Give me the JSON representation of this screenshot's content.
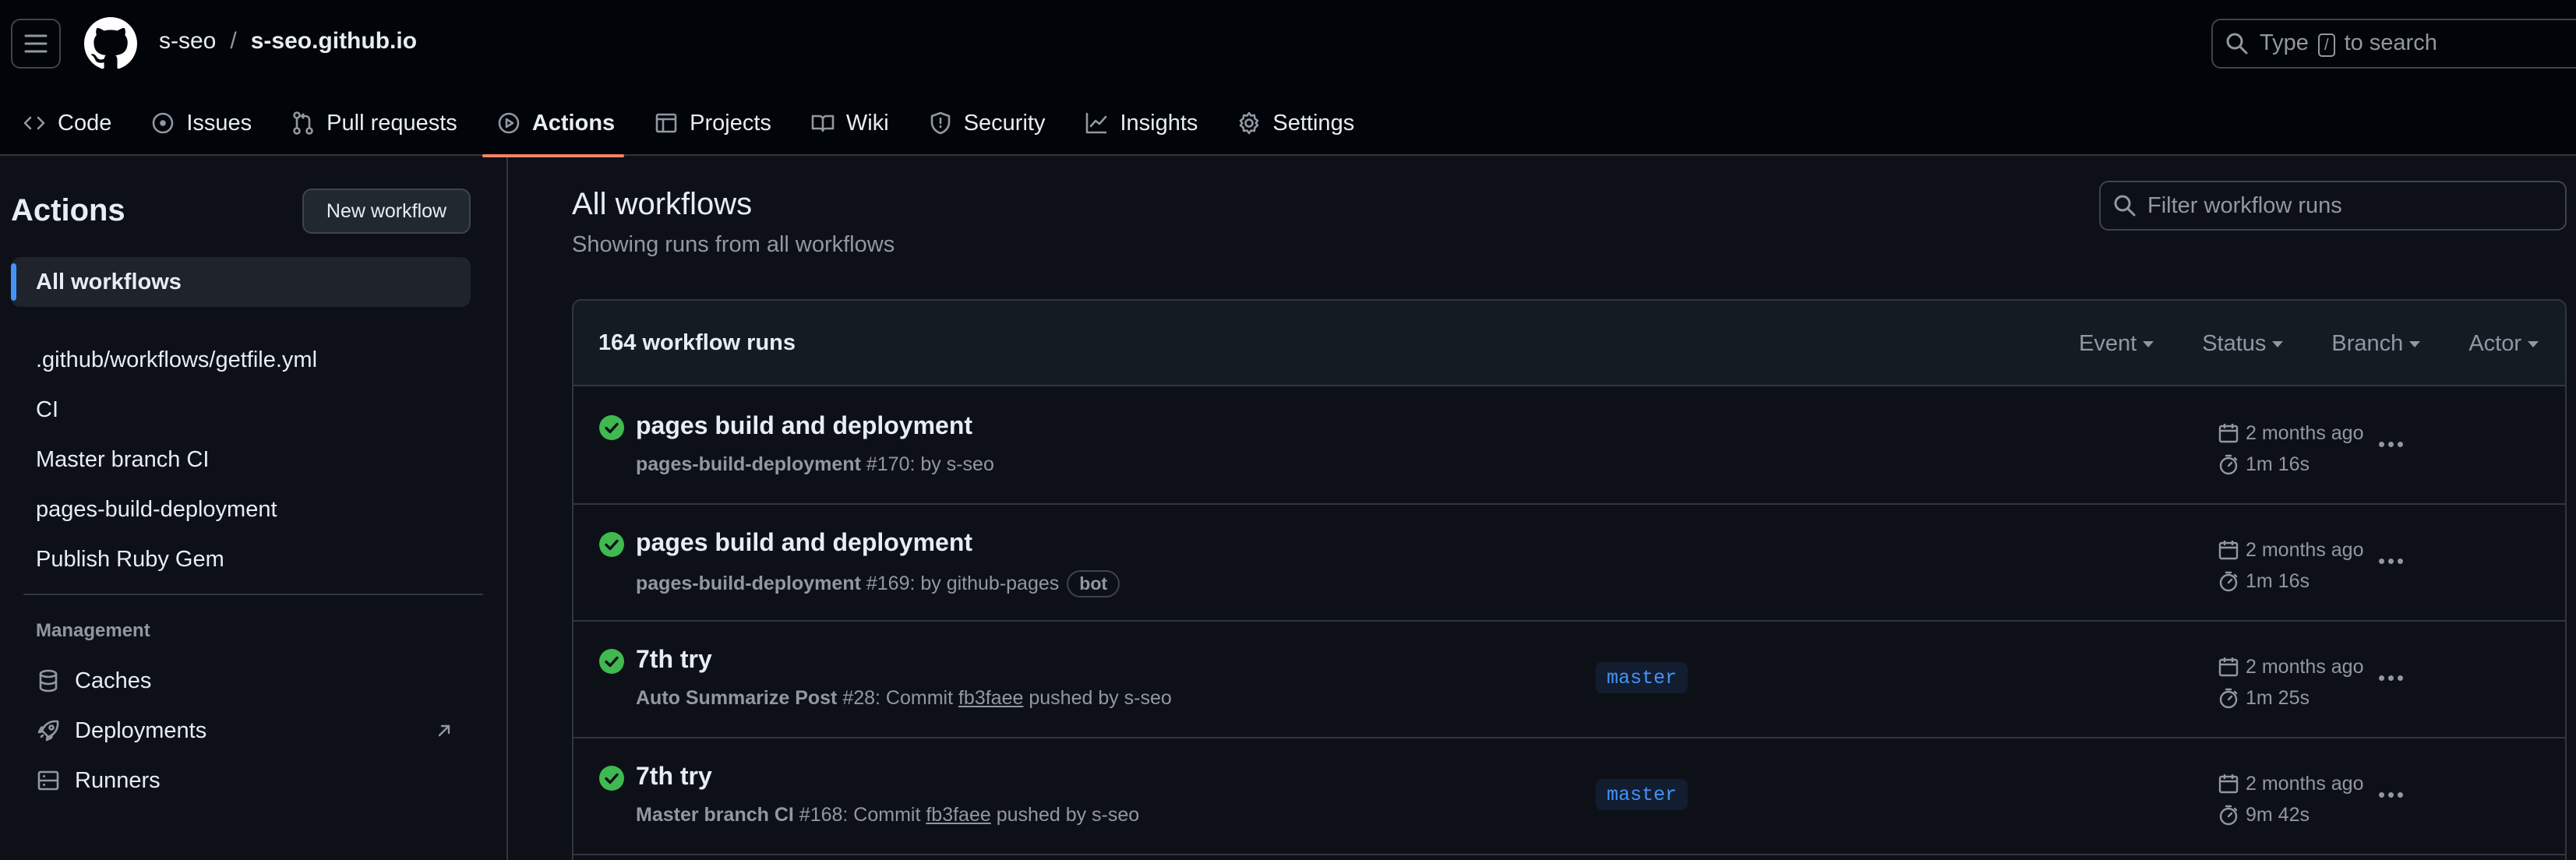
{
  "header": {
    "owner": "s-seo",
    "separator": "/",
    "repo": "s-seo.github.io",
    "search_prefix": "Type",
    "search_key": "/",
    "search_suffix": "to search"
  },
  "nav": [
    {
      "label": "Code",
      "icon": "code-icon"
    },
    {
      "label": "Issues",
      "icon": "issue-icon"
    },
    {
      "label": "Pull requests",
      "icon": "pull-request-icon"
    },
    {
      "label": "Actions",
      "icon": "play-icon",
      "active": true
    },
    {
      "label": "Projects",
      "icon": "table-icon"
    },
    {
      "label": "Wiki",
      "icon": "book-icon"
    },
    {
      "label": "Security",
      "icon": "shield-icon"
    },
    {
      "label": "Insights",
      "icon": "graph-icon"
    },
    {
      "label": "Settings",
      "icon": "gear-icon"
    }
  ],
  "sidebar": {
    "title": "Actions",
    "new_workflow": "New workflow",
    "all_workflows": "All workflows",
    "workflows": [
      ".github/workflows/getfile.yml",
      "CI",
      "Master branch CI",
      "pages-build-deployment",
      "Publish Ruby Gem"
    ],
    "management_label": "Management",
    "management": [
      {
        "label": "Caches",
        "icon": "database-icon"
      },
      {
        "label": "Deployments",
        "icon": "rocket-icon"
      },
      {
        "label": "Runners",
        "icon": "server-icon"
      }
    ]
  },
  "main": {
    "title": "All workflows",
    "subtitle": "Showing runs from all workflows",
    "filter_placeholder": "Filter workflow runs",
    "runs_count": "164 workflow runs",
    "filters": [
      "Event",
      "Status",
      "Branch",
      "Actor"
    ],
    "runs": [
      {
        "title": "pages build and deployment",
        "workflow": "pages-build-deployment",
        "detail": " #170: by s-seo",
        "sha": "",
        "detail_after": "",
        "badge": "",
        "branch": "",
        "date": "2 months ago",
        "duration": "1m 16s"
      },
      {
        "title": "pages build and deployment",
        "workflow": "pages-build-deployment",
        "detail": " #169: by github-pages",
        "sha": "",
        "detail_after": "",
        "badge": "bot",
        "branch": "",
        "date": "2 months ago",
        "duration": "1m 16s"
      },
      {
        "title": "7th try",
        "workflow": "Auto Summarize Post",
        "detail": " #28: Commit ",
        "sha": "fb3faee",
        "detail_after": " pushed by s-seo",
        "badge": "",
        "branch": "master",
        "date": "2 months ago",
        "duration": "1m 25s"
      },
      {
        "title": "7th try",
        "workflow": "Master branch CI",
        "detail": " #168: Commit ",
        "sha": "fb3faee",
        "detail_after": " pushed by s-seo",
        "badge": "",
        "branch": "master",
        "date": "2 months ago",
        "duration": "9m 42s"
      }
    ]
  },
  "colors": {
    "accent": "#4493f8",
    "success": "#3fb950",
    "active_underline": "#f78166"
  }
}
